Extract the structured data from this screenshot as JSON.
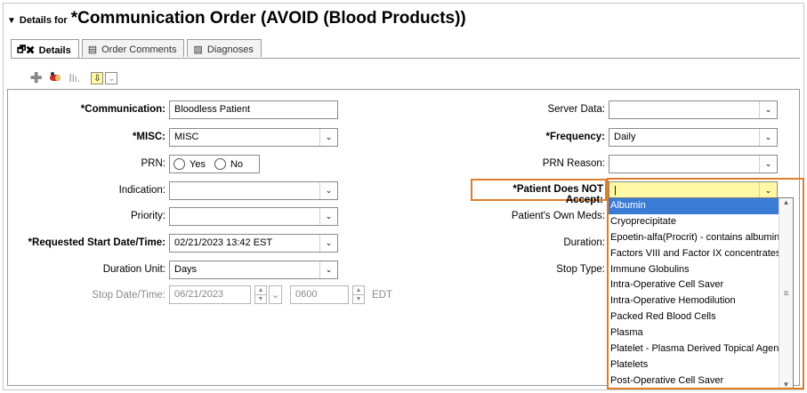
{
  "header": {
    "collapse_glyph": "▼",
    "details_for": "Details for",
    "title": "*Communication Order (AVOID (Blood Products))"
  },
  "tabs": [
    {
      "label": "Details",
      "icon": "details-icon",
      "active": true
    },
    {
      "label": "Order Comments",
      "icon": "comments-icon",
      "active": false
    },
    {
      "label": "Diagnoses",
      "icon": "diagnoses-icon",
      "active": false
    }
  ],
  "toolbar": {
    "add_glyph": "✚",
    "med_glyph": "💊",
    "bars_glyph": "Ⅰlı.",
    "arrow_glyph": "⇩",
    "chev_glyph": "⌄"
  },
  "left": {
    "communication": {
      "label": "*Communication:",
      "value": "Bloodless Patient"
    },
    "misc": {
      "label": "*MISC:",
      "value": "MISC"
    },
    "prn": {
      "label": "PRN:",
      "yes": "Yes",
      "no": "No"
    },
    "indication": {
      "label": "Indication:",
      "value": ""
    },
    "priority": {
      "label": "Priority:",
      "value": ""
    },
    "start": {
      "label": "*Requested Start Date/Time:",
      "value": "02/21/2023 13:42 EST"
    },
    "duration_unit": {
      "label": "Duration Unit:",
      "value": "Days"
    },
    "stop": {
      "label": "Stop Date/Time:",
      "date": "06/21/2023",
      "time": "0600",
      "tz": "EDT"
    }
  },
  "right": {
    "server_data": {
      "label": "Server Data:",
      "value": ""
    },
    "frequency": {
      "label": "*Frequency:",
      "value": "Daily"
    },
    "prn_reason": {
      "label": "PRN Reason:",
      "value": ""
    },
    "not_accept": {
      "label": "*Patient Does NOT Accept:",
      "value": "|"
    },
    "own_meds": {
      "label": "Patient's Own Meds:"
    },
    "duration": {
      "label": "Duration:"
    },
    "stop_type": {
      "label": "Stop Type:"
    }
  },
  "dropdown_options": [
    "Albumin",
    "Cryoprecipitate",
    "Epoetin-alfa(Procrit) - contains albumin",
    "Factors VIII and Factor IX concentrates",
    "Immune Globulins",
    "Intra-Operative Cell Saver",
    "Intra-Operative Hemodilution",
    "Packed Red Blood Cells",
    "Plasma",
    "Platelet - Plasma Derived Topical Agents",
    "Platelets",
    "Post-Operative Cell Saver"
  ],
  "glyphs": {
    "dropdown": "⌄",
    "up": "▲",
    "down": "▼",
    "grip": "≡"
  },
  "colors": {
    "highlight": "#e07d2a",
    "selection": "#3a7bd5",
    "yellow_field": "#fff9a5"
  }
}
